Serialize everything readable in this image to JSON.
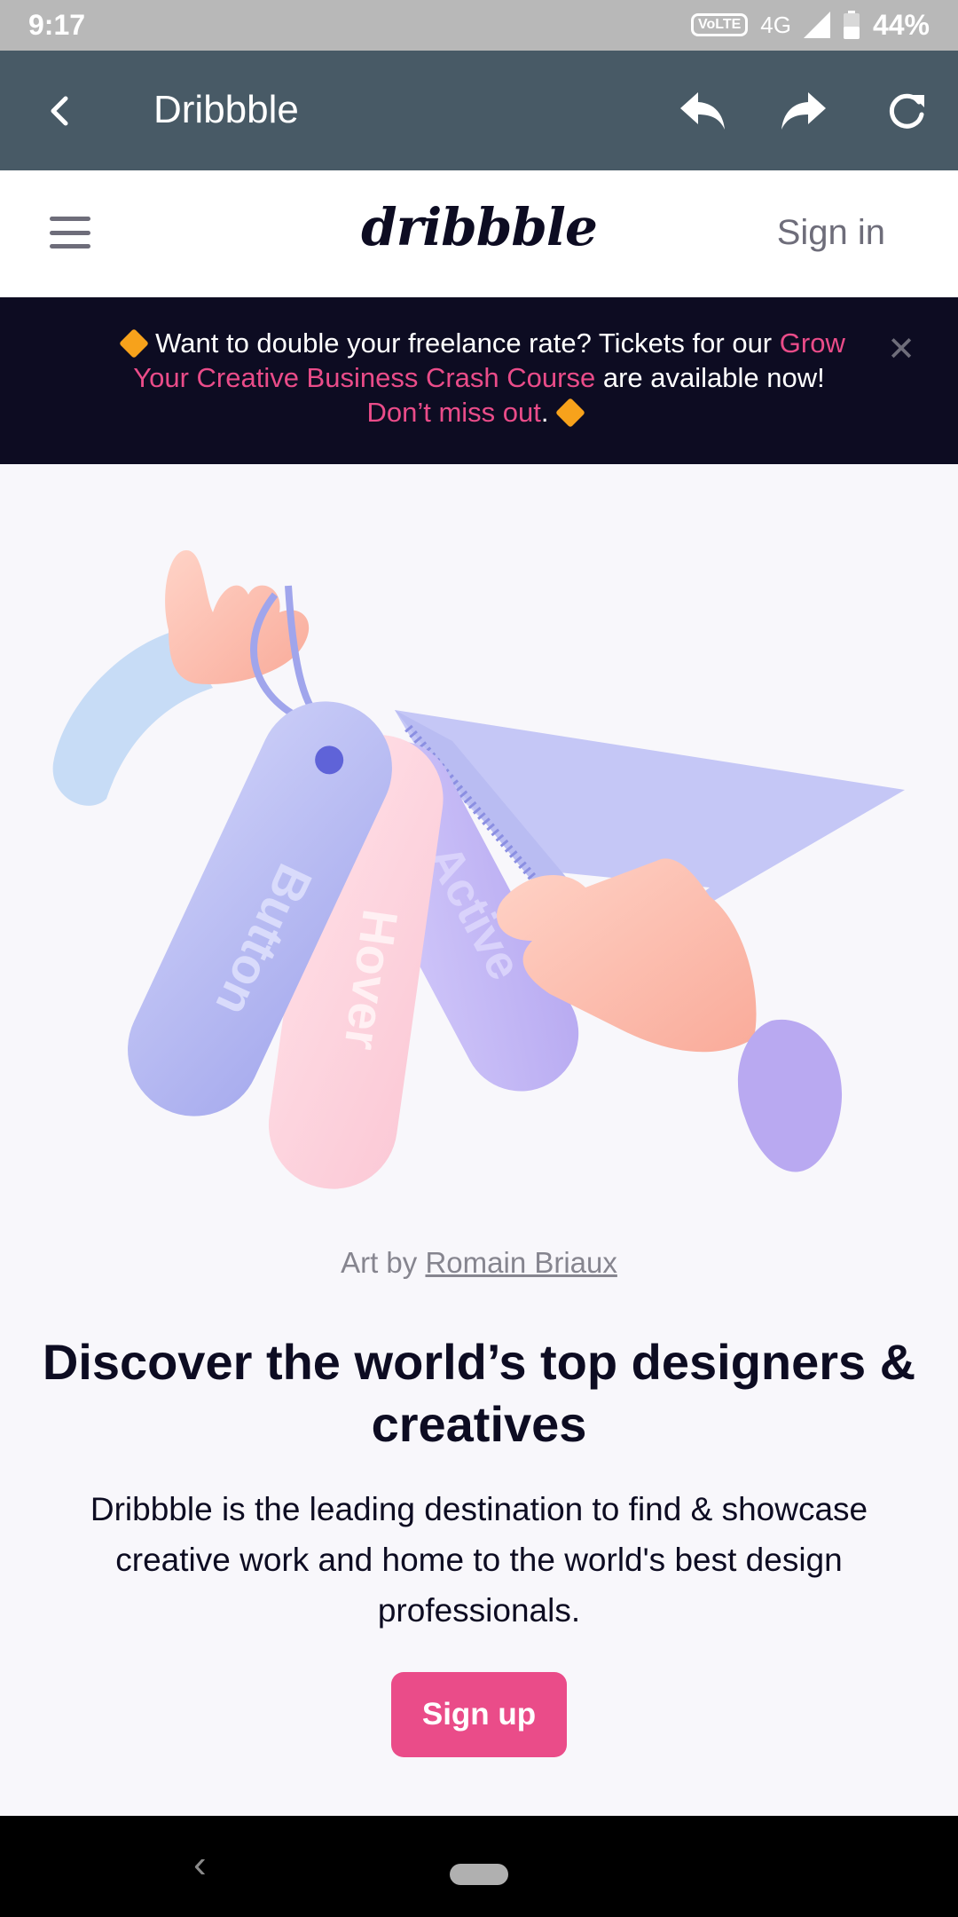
{
  "status_bar": {
    "time": "9:17",
    "volte": "VoLTE",
    "network": "4G",
    "battery": "44%"
  },
  "app_bar": {
    "title": "Dribbble"
  },
  "header": {
    "logo": "dribbble",
    "sign_in": "Sign in"
  },
  "banner": {
    "text_1": "Want to double your freelance rate? Tickets for our",
    "link_1": "Grow Your Creative Business Crash Course",
    "text_2": "are available now!",
    "link_2": "Don’t miss out",
    "text_3": ".",
    "close": "✕"
  },
  "hero": {
    "tag_labels": [
      "Button",
      "Hover",
      "Active"
    ]
  },
  "credit": {
    "prefix": "Art by",
    "author": "Romain Briaux"
  },
  "headline": "Discover the world’s top designers & creatives",
  "subtext": "Dribbble is the leading destination to find & showcase creative work and home to the world's best design professionals.",
  "cta": {
    "label": "Sign up"
  },
  "colors": {
    "accent": "#ea4c89",
    "dark": "#0d0c22",
    "app_bar": "#485a66",
    "gray": "#6e6d7a"
  }
}
